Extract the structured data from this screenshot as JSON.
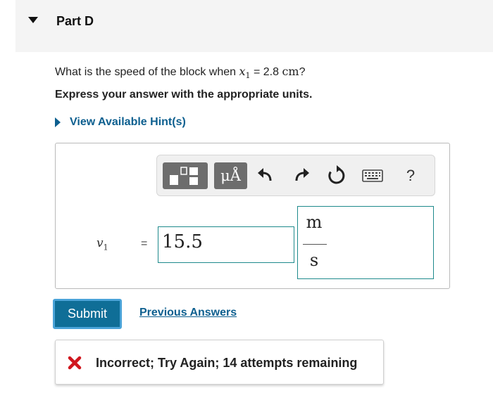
{
  "part": {
    "title": "Part D"
  },
  "question": {
    "prefix": "What is the speed of the block when ",
    "var": "x",
    "sub": "1",
    "eq": " = 2.8 ",
    "unit": "cm",
    "suffix": "?"
  },
  "instruction": "Express your answer with the appropriate units.",
  "hint": {
    "label": "View Available Hint(s)"
  },
  "toolbar": {
    "units_label": "μÅ",
    "help_label": "?",
    "icons": [
      "templates-icon",
      "units-icon",
      "undo-icon",
      "redo-icon",
      "reset-icon",
      "keyboard-icon",
      "help-icon"
    ]
  },
  "answer": {
    "var": "v",
    "sub": "1",
    "equals": "=",
    "value": "15.5",
    "unit_numerator": "m",
    "unit_denominator": "s"
  },
  "actions": {
    "submit_label": "Submit",
    "previous_answers_label": "Previous Answers"
  },
  "feedback": {
    "text": "Incorrect; Try Again; 14 attempts remaining",
    "color": "#d0161e"
  },
  "colors": {
    "link": "#0d5f8f",
    "submit": "#0f6e97",
    "input_border": "#1e8a8c"
  }
}
